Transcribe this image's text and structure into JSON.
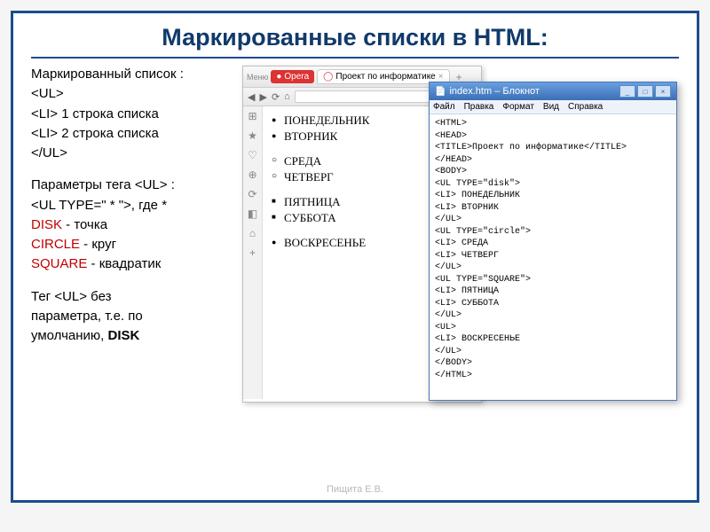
{
  "title": "Маркированные списки в HTML:",
  "left": {
    "l1": "Маркированный список :",
    "l2": "<UL>",
    "l3": "<LI> 1 строка списка",
    "l4": "<LI> 2 строка списка",
    "l5": "</UL>",
    "l6a": "Параметры тега ",
    "l6b": "<UL>",
    "l6c": " :",
    "l7a": "<UL  TYPE=\" * \">",
    "l7b": ", где *",
    "d1a": "DISK",
    "d1b": "  - точка",
    "d2a": "CIRCLE",
    "d2b": "  - круг",
    "d3a": "SQUARE",
    "d3b": "  - квадратик",
    "t1a": "Тег ",
    "t1b": "<UL>",
    "t1c": "  без",
    "t2": "параметра, т.е. по",
    "t3a": "умолчанию, ",
    "t3b": "DISK"
  },
  "browser": {
    "menu_label": "Меню",
    "opera_label": "Opera",
    "tab_label": "Проект по информатике",
    "sidebar": [
      "⊞",
      "★",
      "♡",
      "⊕",
      "⟳",
      "◧",
      "⌂",
      "+"
    ],
    "nav": [
      "◀",
      "▶",
      "⟳",
      "⌂"
    ],
    "list_disc": [
      "ПОНЕДЕЛЬНИК",
      "ВТОРНИК"
    ],
    "list_circle": [
      "СРЕДА",
      "ЧЕТВЕРГ"
    ],
    "list_square": [
      "ПЯТНИЦА",
      "СУББОТА"
    ],
    "list_plain": [
      "ВОСКРЕСЕНЬЕ"
    ]
  },
  "notepad": {
    "title": "index.htm – Блокнот",
    "menu": [
      "Файл",
      "Правка",
      "Формат",
      "Вид",
      "Справка"
    ],
    "code": "<HTML>\n<HEAD>\n<TITLE>Проект по информатике</TITLE>\n</HEAD>\n<BODY>\n<UL TYPE=\"disk\">\n<LI> ПОНЕДЕЛЬНИК\n<LI> ВТОРНИК\n</UL>\n<UL TYPE=\"circle\">\n<LI> СРЕДА\n<LI> ЧЕТВЕРГ\n</UL>\n<UL TYPE=\"SQUARE\">\n<LI> ПЯТНИЦА\n<LI> СУББОТА\n</UL>\n<UL>\n<LI> ВОСКРЕСЕНЬЕ\n</UL>\n</BODY>\n</HTML>"
  },
  "footer": "Пищита Е.В."
}
